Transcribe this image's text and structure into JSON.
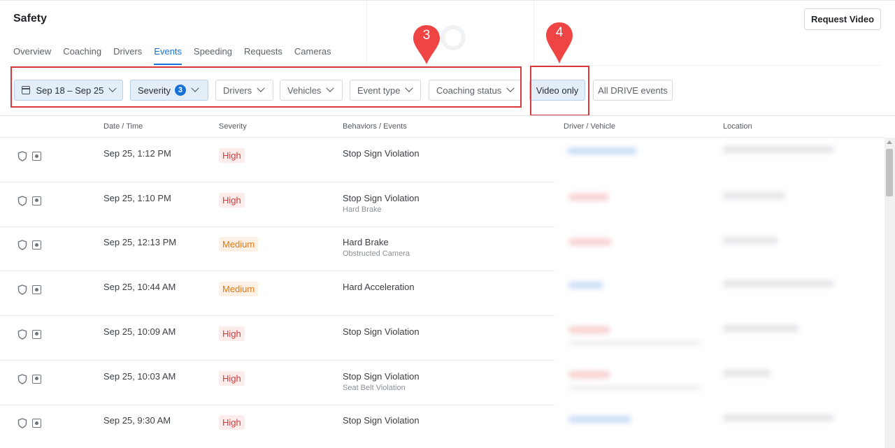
{
  "app": {
    "title": "Safety",
    "request_button": "Request Video"
  },
  "tabs": [
    {
      "label": "Overview",
      "active": false
    },
    {
      "label": "Coaching",
      "active": false
    },
    {
      "label": "Drivers",
      "active": false
    },
    {
      "label": "Events",
      "active": true
    },
    {
      "label": "Speeding",
      "active": false
    },
    {
      "label": "Requests",
      "active": false
    },
    {
      "label": "Cameras",
      "active": false
    }
  ],
  "filters": {
    "date_range": "Sep 18 – Sep 25",
    "severity": "Severity",
    "severity_count": "3",
    "drivers": "Drivers",
    "vehicles": "Vehicles",
    "event_type": "Event type",
    "coaching_status": "Coaching status",
    "video_only": "Video only",
    "all_drive_events": "All DRIVE events"
  },
  "callouts": {
    "first": "3",
    "second": "4",
    "color": "#d63a3a",
    "pin_color": "#ee4444"
  },
  "table": {
    "headers": [
      "Date / Time",
      "Severity",
      "Behaviors / Events",
      "Driver / Vehicle",
      "Location"
    ],
    "rows": [
      {
        "datetime": "Sep 25, 1:12 PM",
        "severity": "High",
        "behavior": "Stop Sign Violation",
        "sub": ""
      },
      {
        "datetime": "Sep 25, 1:10 PM",
        "severity": "High",
        "behavior": "Stop Sign Violation",
        "sub": "Hard Brake"
      },
      {
        "datetime": "Sep 25, 12:13 PM",
        "severity": "Medium",
        "behavior": "Hard Brake",
        "sub": "Obstructed Camera"
      },
      {
        "datetime": "Sep 25, 10:44 AM",
        "severity": "Medium",
        "behavior": "Hard Acceleration",
        "sub": ""
      },
      {
        "datetime": "Sep 25, 10:09 AM",
        "severity": "High",
        "behavior": "Stop Sign Violation",
        "sub": ""
      },
      {
        "datetime": "Sep 25, 10:03 AM",
        "severity": "High",
        "behavior": "Stop Sign Violation",
        "sub": "Seat Belt Violation"
      },
      {
        "datetime": "Sep 25, 9:30 AM",
        "severity": "High",
        "behavior": "Stop Sign Violation",
        "sub": ""
      }
    ]
  },
  "colors": {
    "accent": "#1670d6",
    "high": "#d83b3b",
    "medium": "#e07a16"
  },
  "icons": [
    "calendar-icon",
    "chevron-down-icon",
    "shield-icon",
    "camera-icon",
    "map-pin-icon"
  ]
}
